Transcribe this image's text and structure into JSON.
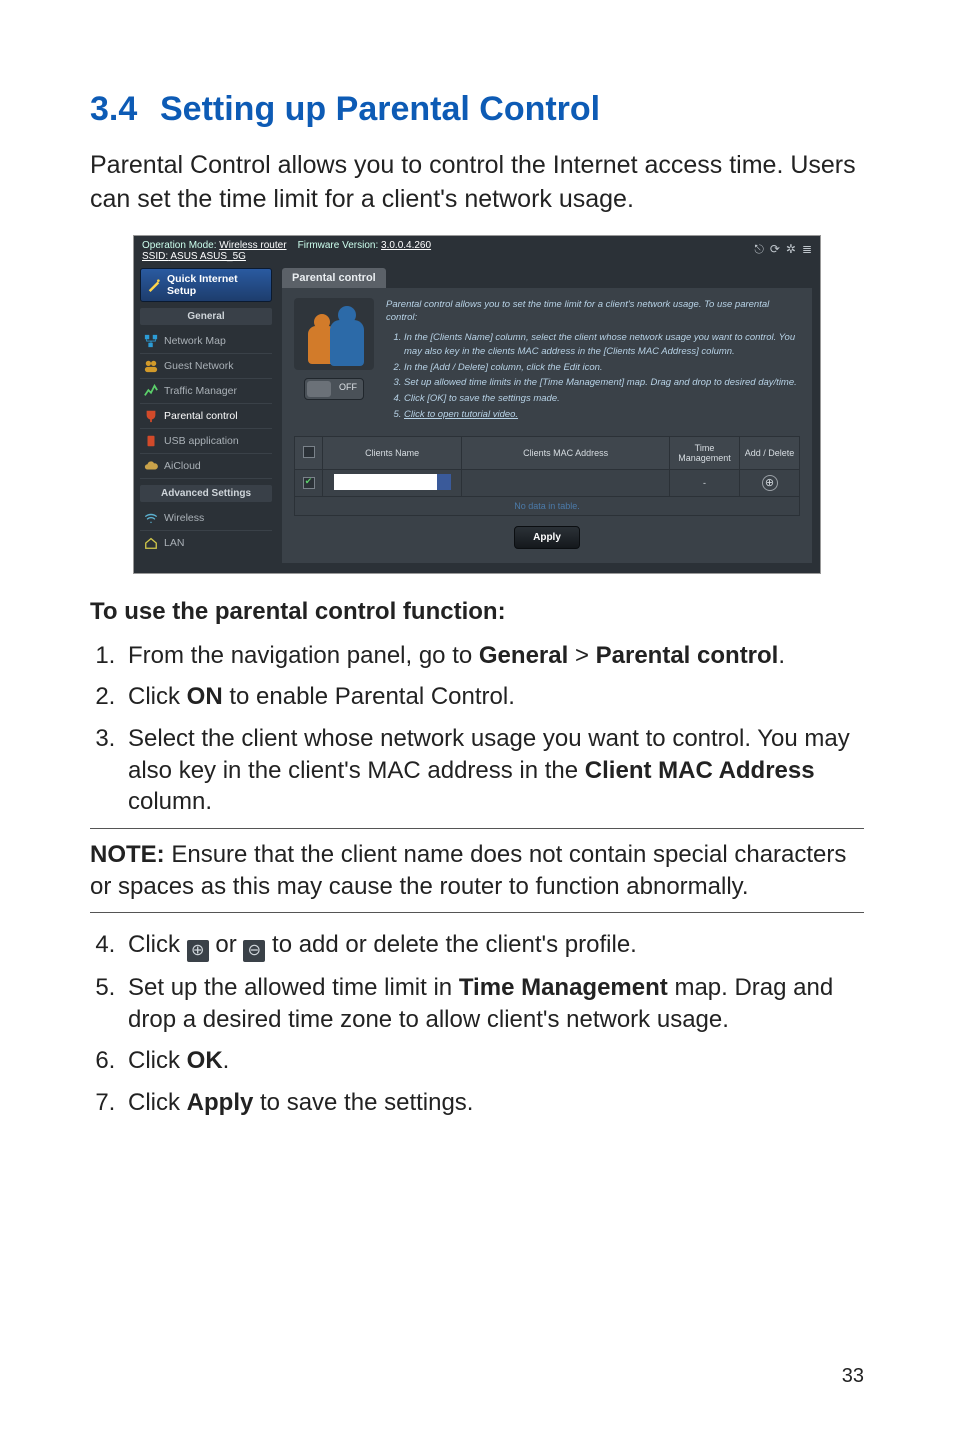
{
  "heading": {
    "num": "3.4",
    "title": "Setting up Parental Control"
  },
  "lead": "Parental Control allows you to control the Internet access time. Users can set the time limit for a client's network usage.",
  "screenshot": {
    "topbar": {
      "opmode_label": "Operation Mode:",
      "opmode_value": "Wireless router",
      "fw_label": "Firmware Version:",
      "fw_value": "3.0.0.4.260",
      "ssid_label": "SSID:",
      "ssid_value": "ASUS ASUS_5G"
    },
    "sidebar": {
      "qis": "Quick Internet Setup",
      "general_label": "General",
      "items": [
        "Network Map",
        "Guest Network",
        "Traffic Manager",
        "Parental control",
        "USB application",
        "AiCloud"
      ],
      "adv_label": "Advanced Settings",
      "adv_items": [
        "Wireless",
        "LAN"
      ]
    },
    "tab": "Parental control",
    "intro_lead": "Parental control allows you to set the time limit for a client's network usage. To use parental control:",
    "intro_steps": [
      "In the [Clients Name] column, select the client whose network usage you want to control. You may also key in the clients MAC address in the [Clients MAC Address] column.",
      "In the [Add / Delete] column, click the Edit icon.",
      "Set up allowed time limits in the [Time Management] map. Drag and drop to desired day/time.",
      "Click [OK] to save the settings made.",
      "Click to open tutorial video."
    ],
    "toggle_label": "OFF",
    "table": {
      "headers": [
        "",
        "Clients Name",
        "Clients MAC Address",
        "Time Management",
        "Add / Delete"
      ],
      "timemgmt_placeholder": "-",
      "nodata": "No data in table."
    },
    "apply": "Apply"
  },
  "subheading": "To use the parental control function:",
  "steps": {
    "s1_a": "From the navigation panel, go to ",
    "s1_b": "General",
    "s1_c": " > ",
    "s1_d": "Parental control",
    "s1_e": ".",
    "s2_a": "Click ",
    "s2_b": "ON",
    "s2_c": " to enable Parental Control.",
    "s3_a": "Select the client whose network usage you want to control. You may also key in the client's MAC address in the ",
    "s3_b": "Client MAC Address",
    "s3_c": " column.",
    "s4_a": "Click ",
    "s4_b": " or ",
    "s4_c": " to add or delete the client's profile.",
    "s5_a": "Set up the allowed time limit in ",
    "s5_b": "Time Management",
    "s5_c": " map. Drag and drop a desired time zone to allow client's network usage.",
    "s6_a": "Click ",
    "s6_b": "OK",
    "s6_c": ".",
    "s7_a": "Click ",
    "s7_b": "Apply",
    "s7_c": " to save the settings."
  },
  "note_label": "NOTE:",
  "note_text": "  Ensure that the client name does not contain special characters or spaces as this may cause the router to function abnormally.",
  "page_number": "33"
}
